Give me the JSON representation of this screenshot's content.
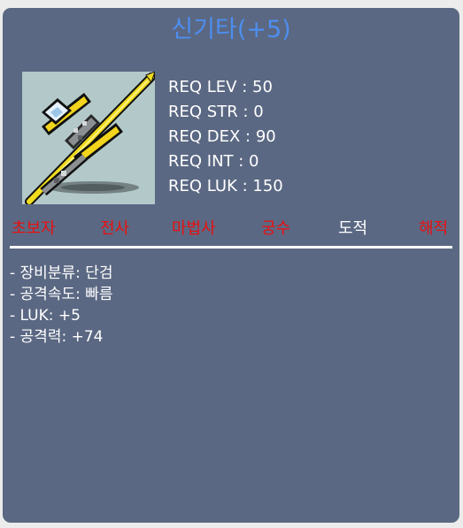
{
  "item": {
    "name": "신기타(+5)",
    "icon": "golden-guitar-dagger-icon"
  },
  "requirements": [
    "REQ LEV : 50",
    "REQ STR : 0",
    "REQ DEX : 90",
    "REQ INT : 0",
    "REQ LUK : 150"
  ],
  "jobs": [
    {
      "label": "초보자",
      "active": false
    },
    {
      "label": "전사",
      "active": false
    },
    {
      "label": "마법사",
      "active": false
    },
    {
      "label": "궁수",
      "active": false
    },
    {
      "label": "도적",
      "active": true
    },
    {
      "label": "해적",
      "active": false
    }
  ],
  "stats": [
    "- 장비분류: 단검",
    "- 공격속도: 빠름",
    "- LUK: +5",
    "- 공격력: +74"
  ],
  "colors": {
    "background": "#5b6883",
    "title": "#4d8ef0",
    "job_unavailable": "#e81010",
    "job_available": "#ffffff",
    "text": "#ffffff"
  }
}
